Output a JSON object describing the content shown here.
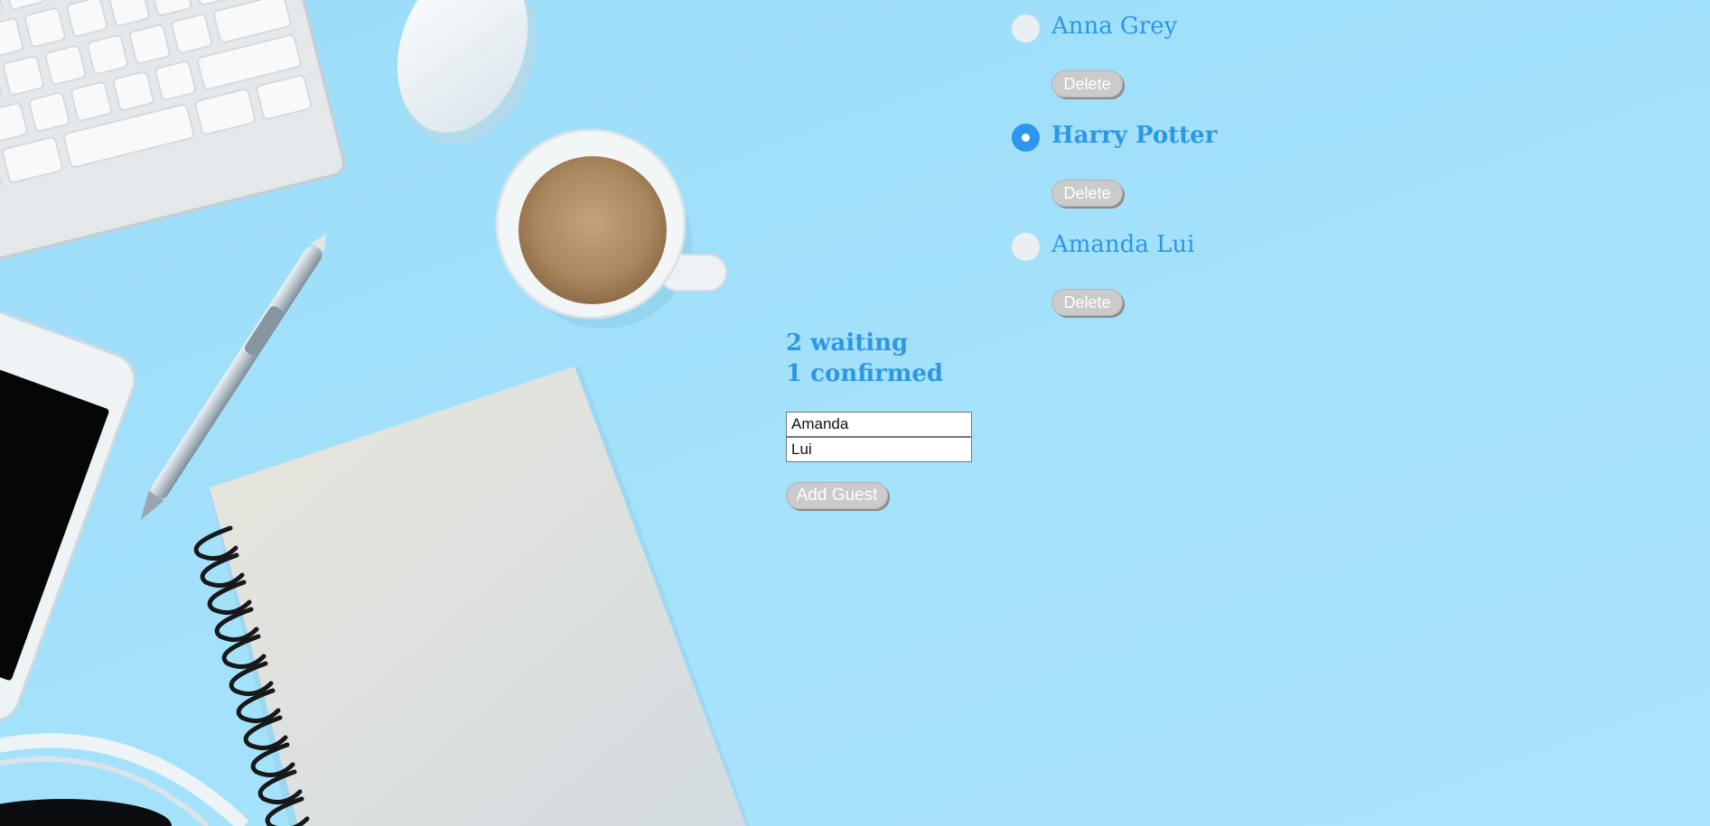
{
  "guests": [
    {
      "name": "Anna Grey",
      "confirmed": false,
      "delete_label": "Delete"
    },
    {
      "name": "Harry Potter",
      "confirmed": true,
      "delete_label": "Delete"
    },
    {
      "name": "Amanda Lui",
      "confirmed": false,
      "delete_label": "Delete"
    }
  ],
  "summary": {
    "waiting": "2 waiting",
    "confirmed": "1 confirmed"
  },
  "form": {
    "first_name_value": "Amanda",
    "last_name_value": "Lui",
    "add_label": "Add Guest"
  },
  "colors": {
    "background": "#a3e1fb",
    "text_accent": "#2d97e6",
    "toggle_checked": "#2d96ef",
    "toggle_unchecked": "#e9eff2",
    "button_bg": "#cbcbcb"
  }
}
